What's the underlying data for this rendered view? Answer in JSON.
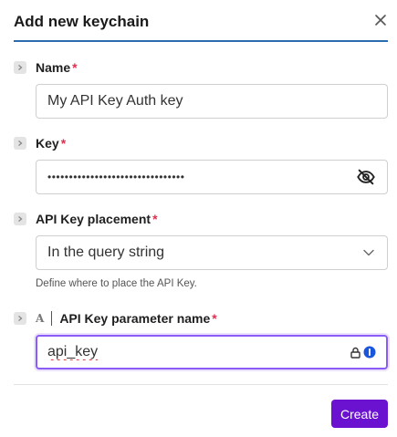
{
  "dialog": {
    "title": "Add new keychain",
    "create_label": "Create"
  },
  "fields": {
    "name": {
      "label": "Name",
      "required_mark": "*",
      "value": "My API Key Auth key"
    },
    "key": {
      "label": "Key",
      "required_mark": "*",
      "value": "••••••••••••••••••••••••••••••••"
    },
    "placement": {
      "label": "API Key placement",
      "required_mark": "*",
      "value": "In the query string",
      "help": "Define where to place the API Key."
    },
    "param_name": {
      "label": "API Key parameter name",
      "required_mark": "*",
      "type_glyph": "A",
      "value": "api_key"
    }
  },
  "colors": {
    "accent": "#6b12d1",
    "header_rule": "#2b6cb0",
    "required": "#e0304f",
    "focus": "#8b5cf6"
  },
  "icons": [
    "close-icon",
    "chevron-right-icon",
    "eye-off-icon",
    "chevron-down-icon",
    "text-type-icon",
    "password-manager-icon"
  ]
}
